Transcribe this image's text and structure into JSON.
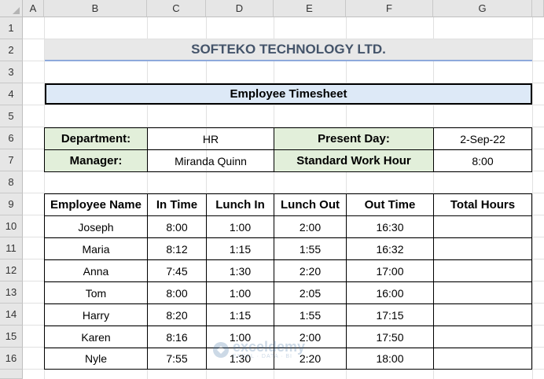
{
  "columns": [
    "A",
    "B",
    "C",
    "D",
    "E",
    "F",
    "G"
  ],
  "rows": [
    "1",
    "2",
    "3",
    "4",
    "5",
    "6",
    "7",
    "8",
    "9",
    "10",
    "11",
    "12",
    "13",
    "14",
    "15",
    "16"
  ],
  "title": "SOFTEKO TECHNOLOGY LTD.",
  "subtitle": "Employee Timesheet",
  "info": {
    "department_label": "Department:",
    "department_value": "HR",
    "manager_label": "Manager:",
    "manager_value": "Miranda Quinn",
    "present_day_label": "Present Day:",
    "present_day_value": "2-Sep-22",
    "work_hour_label": "Standard Work Hour",
    "work_hour_value": "8:00"
  },
  "table": {
    "headers": [
      "Employee Name",
      "In Time",
      "Lunch In",
      "Lunch Out",
      "Out Time",
      "Total Hours"
    ],
    "rows": [
      [
        "Joseph",
        "8:00",
        "1:00",
        "2:00",
        "16:30",
        ""
      ],
      [
        "Maria",
        "8:12",
        "1:15",
        "1:55",
        "16:32",
        ""
      ],
      [
        "Anna",
        "7:45",
        "1:30",
        "2:20",
        "17:00",
        ""
      ],
      [
        "Tom",
        "8:00",
        "1:00",
        "2:05",
        "16:00",
        ""
      ],
      [
        "Harry",
        "8:20",
        "1:15",
        "1:55",
        "17:15",
        ""
      ],
      [
        "Karen",
        "8:16",
        "1:00",
        "2:00",
        "17:50",
        ""
      ],
      [
        "Nyle",
        "7:55",
        "1:30",
        "2:20",
        "18:00",
        ""
      ]
    ]
  },
  "watermark": {
    "name": "exceldemy",
    "tagline": "EXCEL · DATA · BI"
  },
  "colors": {
    "header_bg": "#e6e6e6",
    "title_text": "#44546a",
    "title_underline": "#8ea9db",
    "subtitle_bg": "#dde9f7",
    "label_bg": "#e2efda"
  }
}
